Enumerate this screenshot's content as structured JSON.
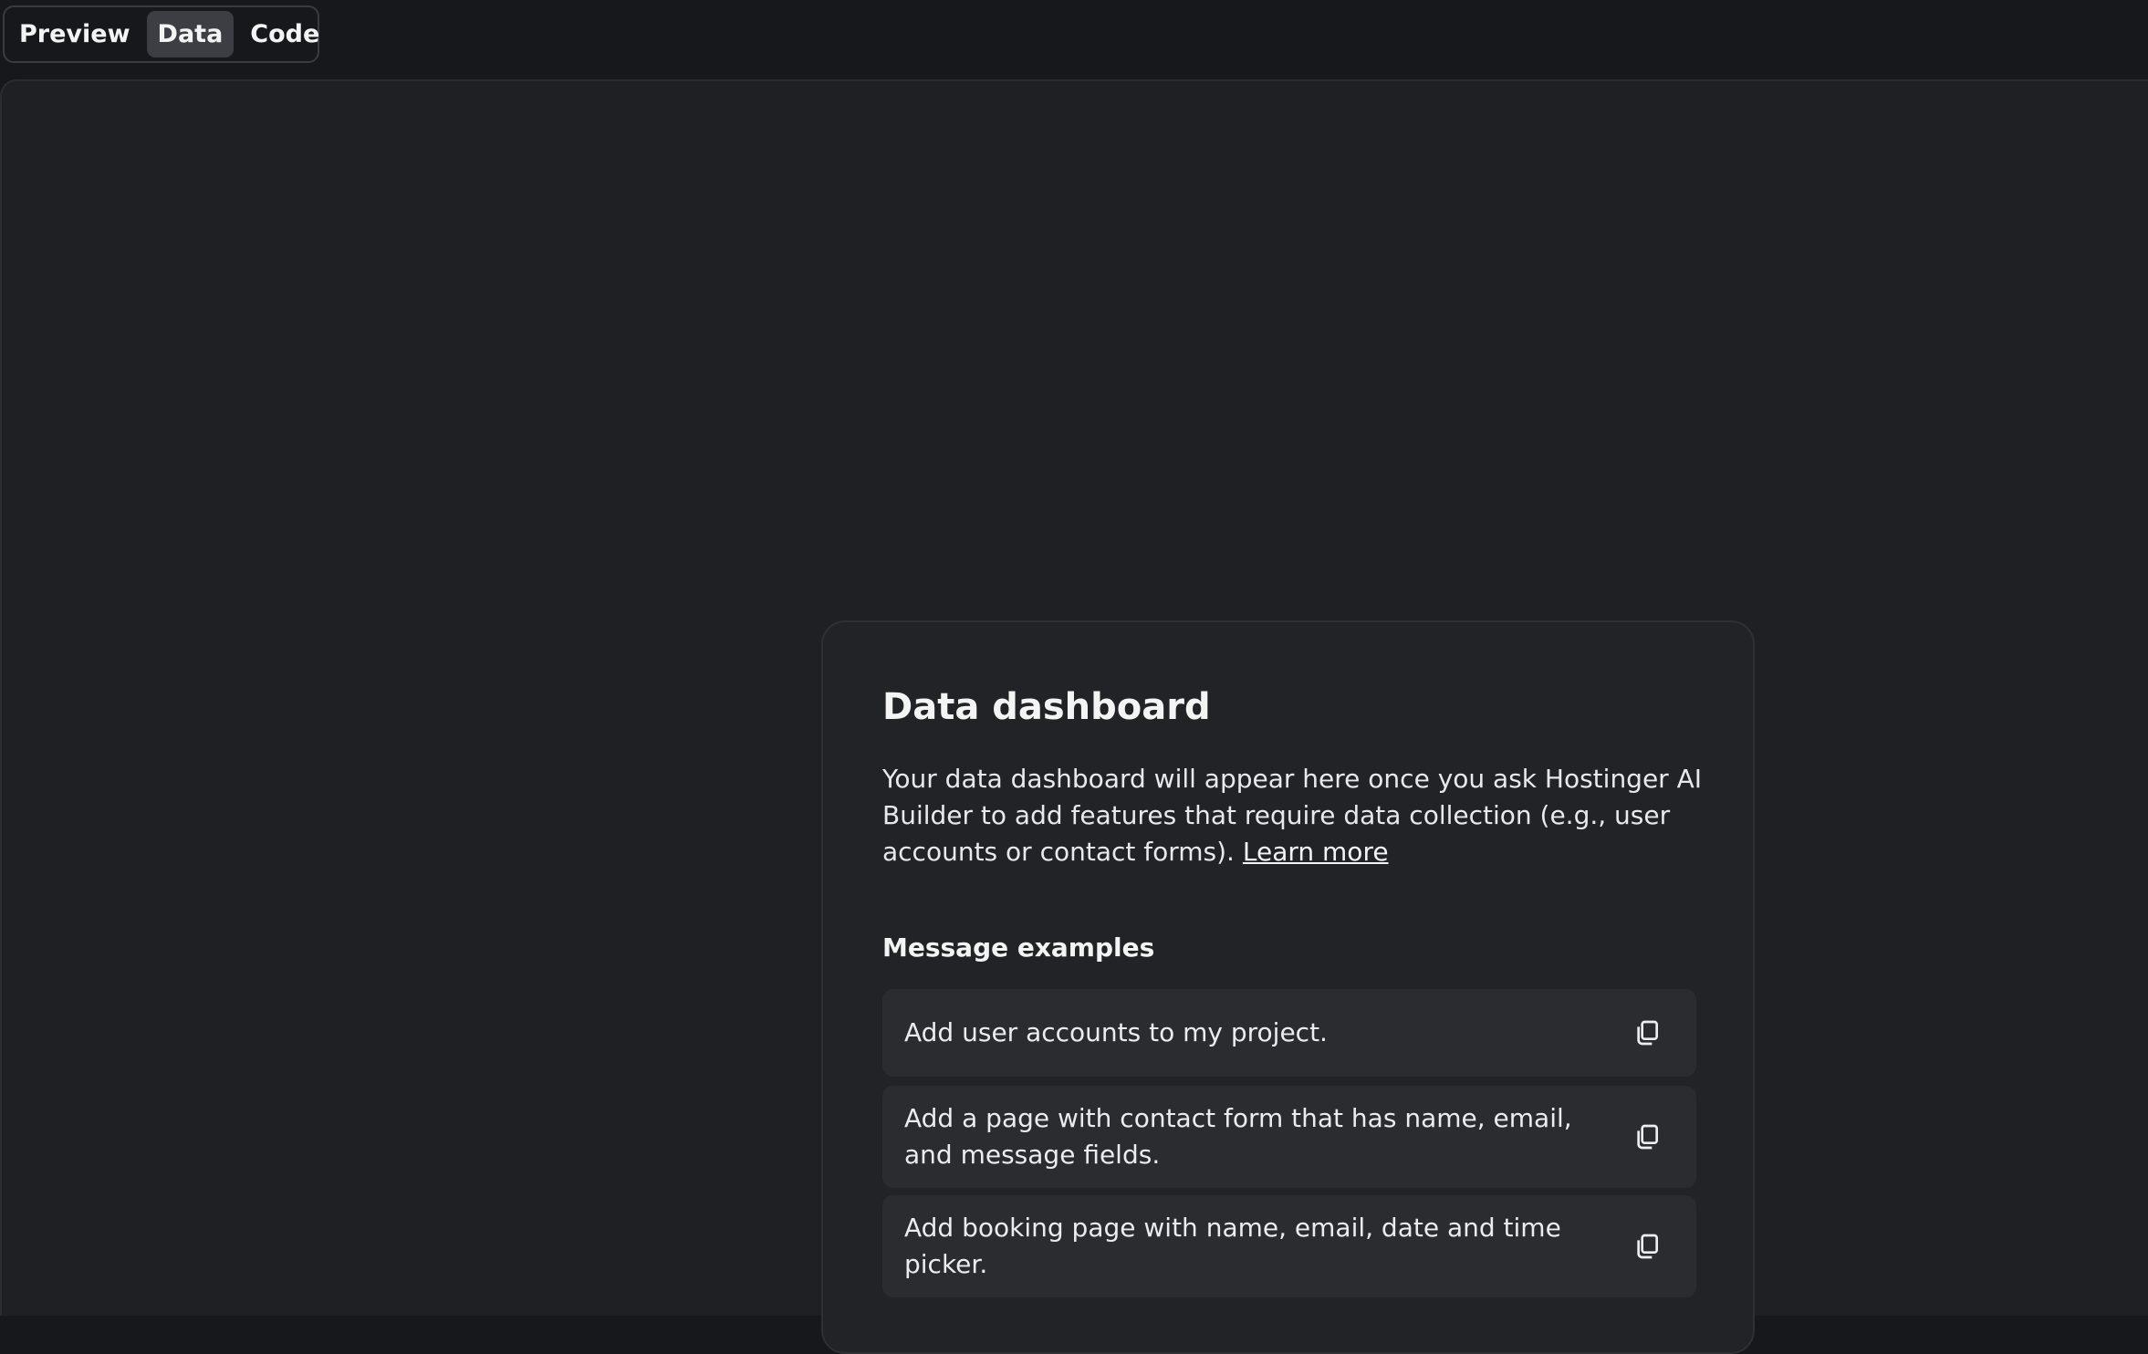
{
  "tabs": [
    {
      "label": "Preview",
      "active": false
    },
    {
      "label": "Data",
      "active": true
    },
    {
      "label": "Code",
      "active": false
    }
  ],
  "card": {
    "title": "Data dashboard",
    "description": "Your data dashboard will appear here once you ask Hostinger AI Builder to add features that require data collection (e.g., user accounts or contact forms).",
    "learn_more": "Learn more",
    "examples_title": "Message examples",
    "examples": [
      {
        "text": "Add user accounts to my project.",
        "icon": "copy-icon"
      },
      {
        "text": "Add a page with contact form that has name, email, and message fields.",
        "icon": "copy-icon"
      },
      {
        "text": "Add booking page with name, email, date and time picker.",
        "icon": "copy-icon"
      }
    ]
  },
  "colors": {
    "background": "#17181b",
    "workspace": "#1f2023",
    "card": "#222326",
    "example": "#2b2c30",
    "active_tab": "#3d3e44"
  }
}
